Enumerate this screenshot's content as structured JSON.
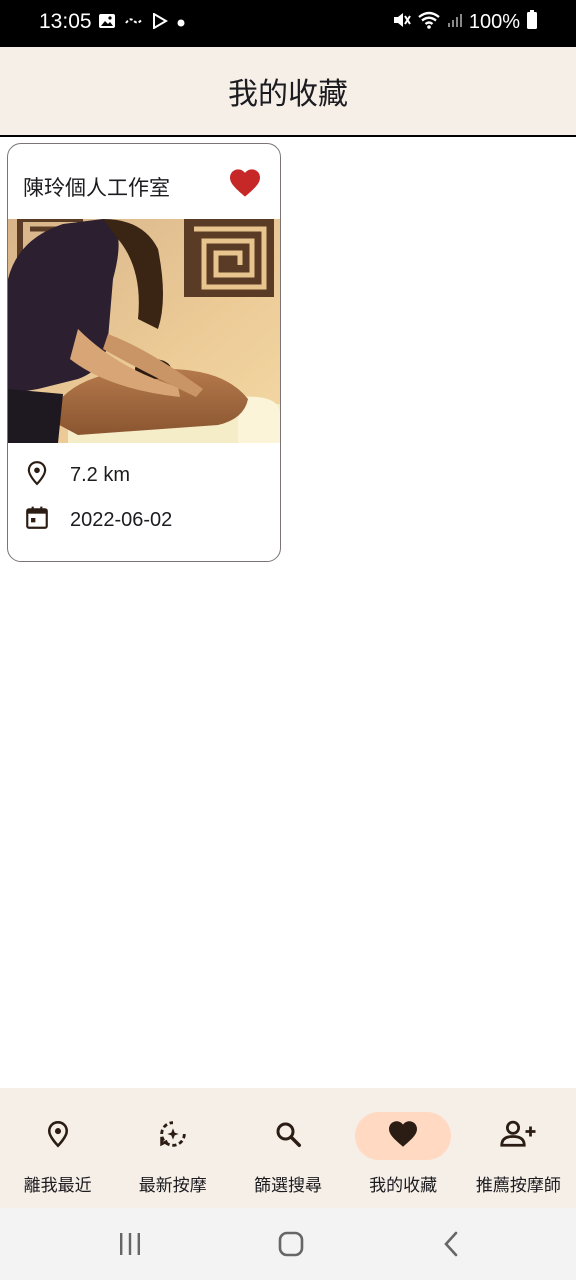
{
  "status_bar": {
    "time": "13:05",
    "battery": "100%",
    "left_icons": [
      "image-icon",
      "wind-icon",
      "play-store-icon",
      "dot-icon"
    ],
    "right_icons": [
      "mute-icon",
      "wifi-icon",
      "signal-icon",
      "battery-icon"
    ]
  },
  "app_bar": {
    "title": "我的收藏"
  },
  "favorites": [
    {
      "name": "陳玲個人工作室",
      "distance": "7.2 km",
      "date": "2022-06-02",
      "favorited": true,
      "image": "massage-photo"
    }
  ],
  "bottom_nav": {
    "items": [
      {
        "label": "離我最近",
        "icon": "location-icon",
        "active": false
      },
      {
        "label": "最新按摩",
        "icon": "new-refresh-icon",
        "active": false
      },
      {
        "label": "篩選搜尋",
        "icon": "search-icon",
        "active": false
      },
      {
        "label": "我的收藏",
        "icon": "heart-icon",
        "active": true
      },
      {
        "label": "推薦按摩師",
        "icon": "add-person-icon",
        "active": false
      }
    ]
  },
  "colors": {
    "app_bar_bg": "#f5efe8",
    "active_pill": "#ffd9c2",
    "heart_red": "#c62828",
    "icon_dark": "#2b1d14"
  }
}
